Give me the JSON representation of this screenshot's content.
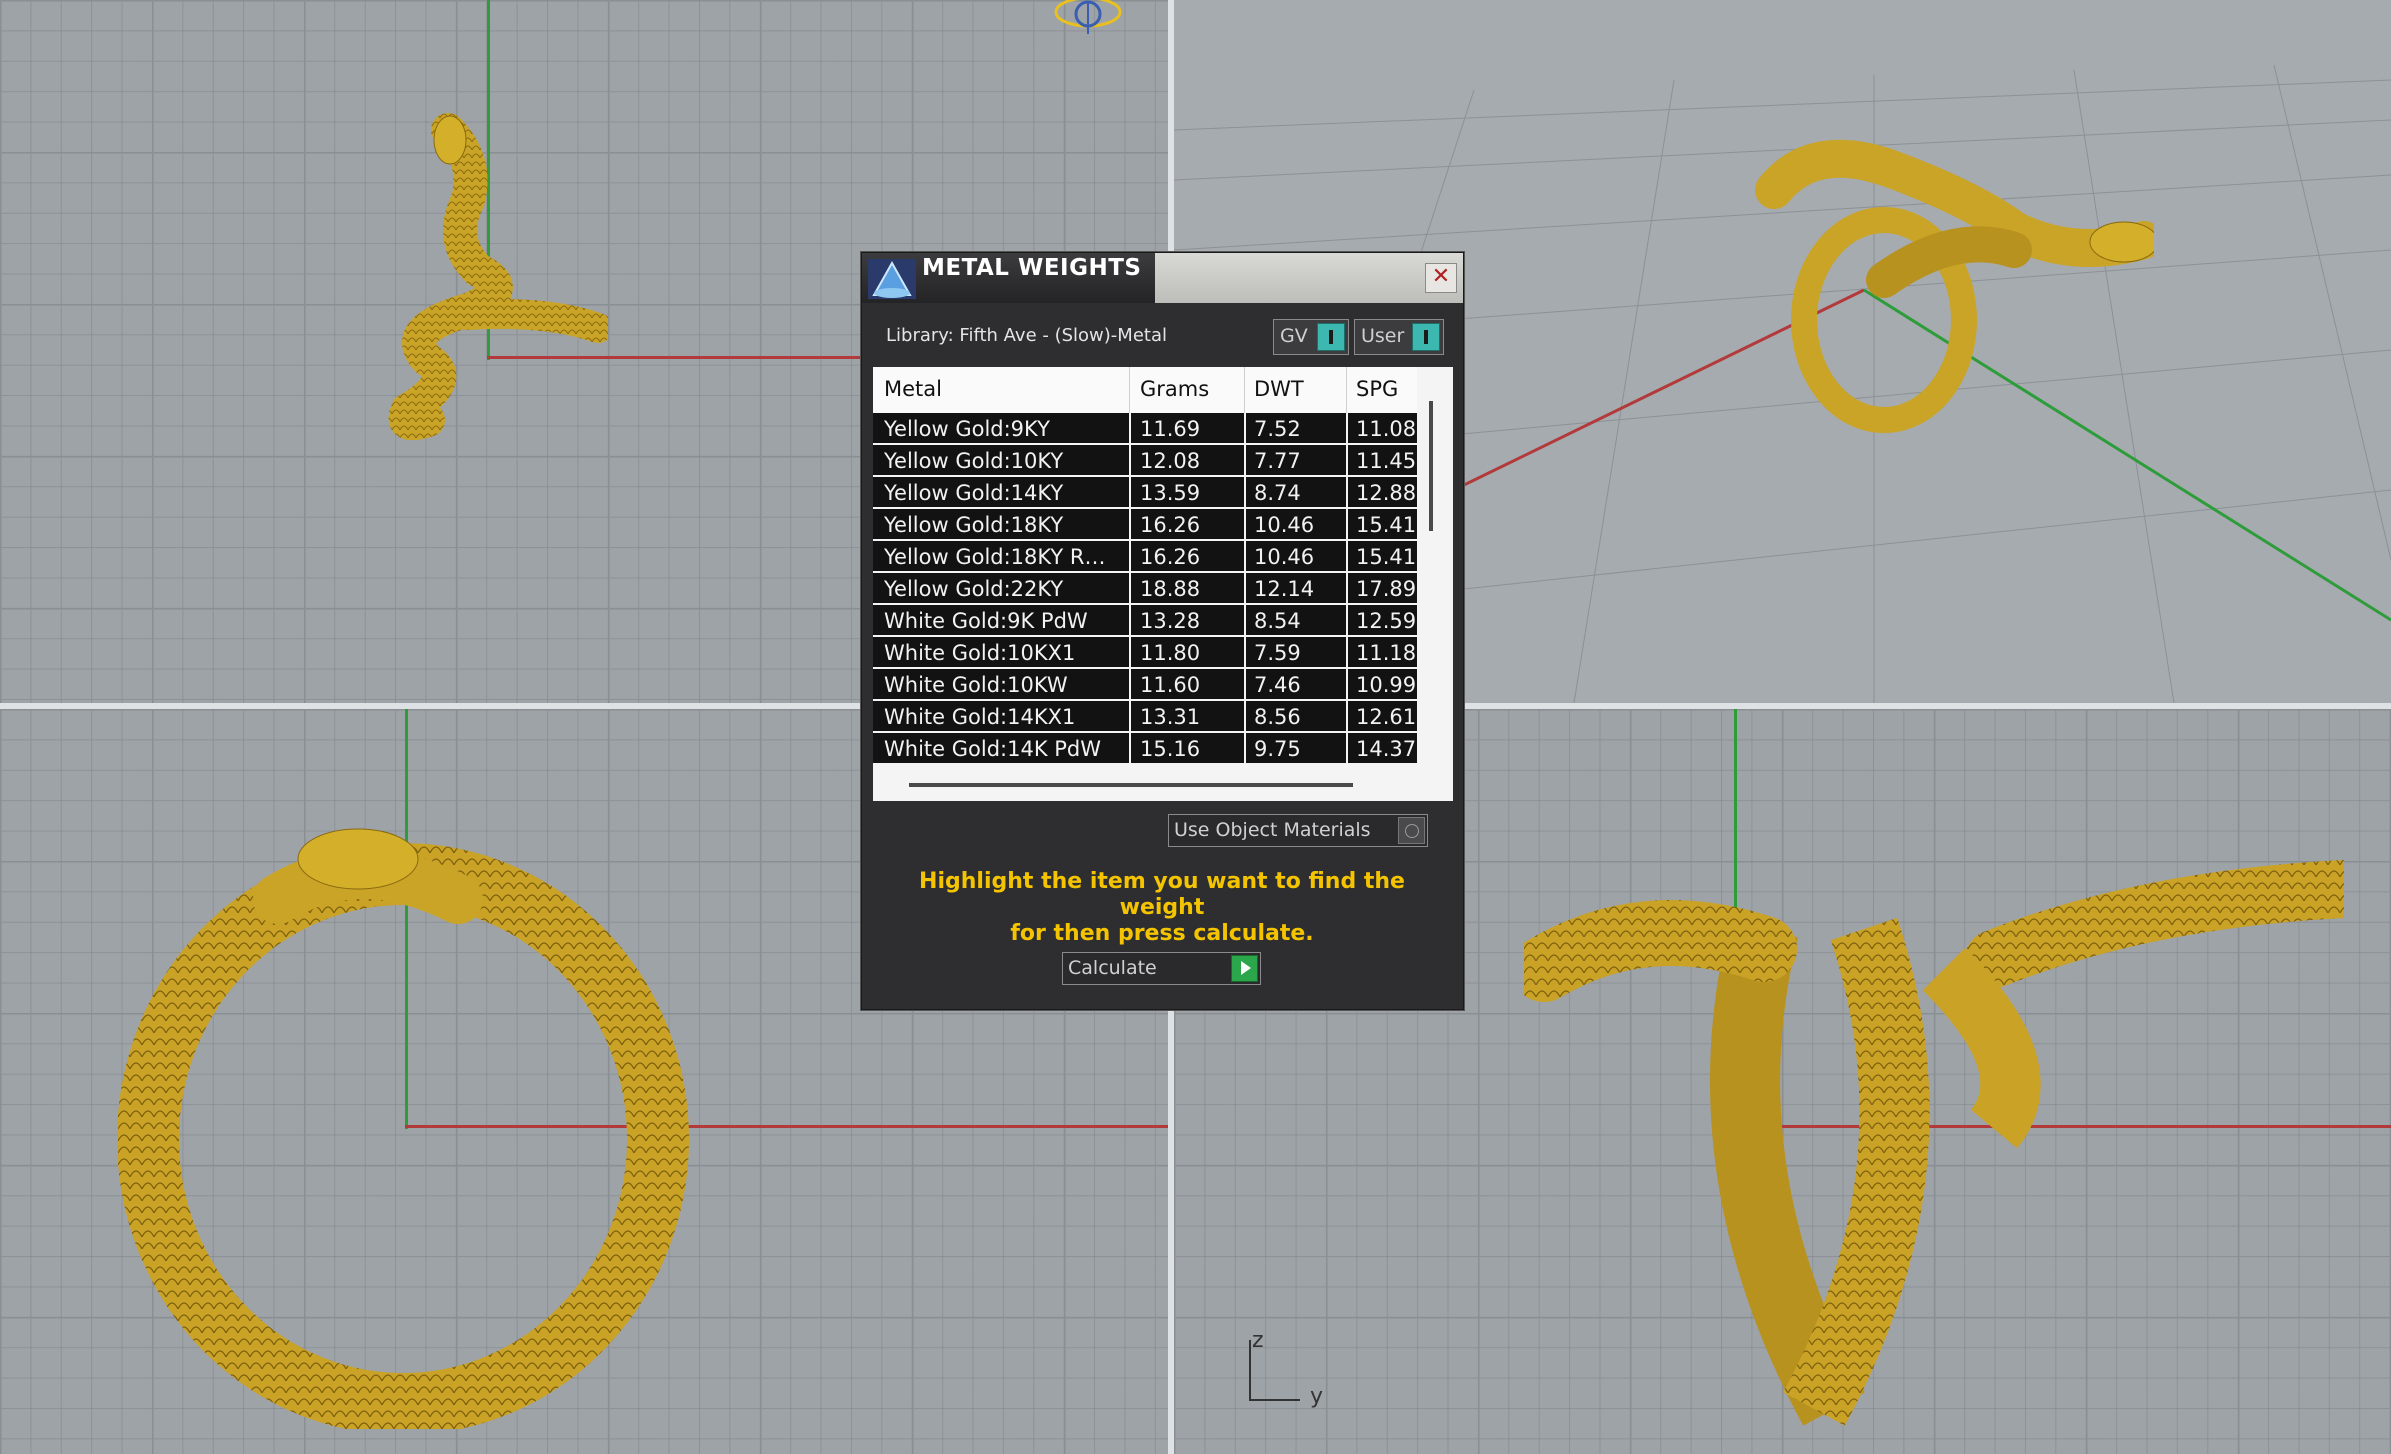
{
  "dialog": {
    "title": "METAL WEIGHTS",
    "close_glyph": "✕",
    "library": "Library: Fifth Ave - (Slow)-Metal",
    "toggles": {
      "gv": "GV",
      "user": "User"
    },
    "table": {
      "columns": [
        "Metal",
        "Grams",
        "DWT",
        "SPG"
      ],
      "rows": [
        [
          "Yellow Gold:9KY",
          "11.69",
          "7.52",
          "11.08"
        ],
        [
          "Yellow Gold:10KY",
          "12.08",
          "7.77",
          "11.45"
        ],
        [
          "Yellow Gold:14KY",
          "13.59",
          "8.74",
          "12.88"
        ],
        [
          "Yellow Gold:18KY",
          "16.26",
          "10.46",
          "15.41"
        ],
        [
          "Yellow Gold:18KY R…",
          "16.26",
          "10.46",
          "15.41"
        ],
        [
          "Yellow Gold:22KY",
          "18.88",
          "12.14",
          "17.89"
        ],
        [
          "White Gold:9K PdW",
          "13.28",
          "8.54",
          "12.59"
        ],
        [
          "White Gold:10KX1",
          "11.80",
          "7.59",
          "11.18"
        ],
        [
          "White Gold:10KW",
          "11.60",
          "7.46",
          "10.99"
        ],
        [
          "White Gold:14KX1",
          "13.31",
          "8.56",
          "12.61"
        ],
        [
          "White Gold:14K PdW",
          "15.16",
          "9.75",
          "14.37"
        ]
      ]
    },
    "use_object_materials": "Use Object Materials",
    "hint_line1": "Highlight the item you want to find the weight",
    "hint_line2": "for then press calculate.",
    "calculate": "Calculate"
  },
  "axis_icon": {
    "z": "z",
    "y": "y"
  },
  "colors": {
    "gold": "#d4b02a",
    "hint": "#f5c400",
    "toggle_accent": "#3cb8b0"
  },
  "icons": [
    "metal-weights-logo-icon",
    "close-icon",
    "gumball-globe-icon",
    "play-icon",
    "radio-icon"
  ]
}
